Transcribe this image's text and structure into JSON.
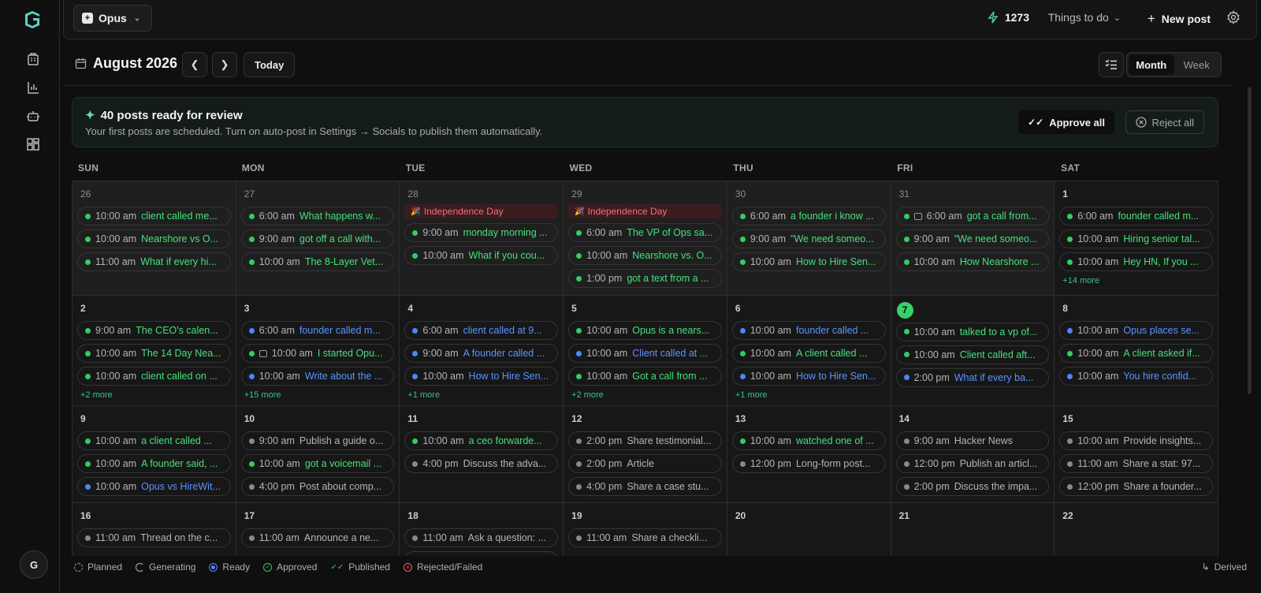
{
  "sidebar": {
    "logo": "logo-icon",
    "icons": [
      "building-icon",
      "bar-chart-icon",
      "bot-icon",
      "grid-icon"
    ],
    "avatar_initial": "G"
  },
  "topbar": {
    "workspace": "Opus",
    "credits": "1273",
    "todo_label": "Things to do",
    "new_post_label": "New post"
  },
  "calendar": {
    "month_title": "August 2026",
    "today_label": "Today",
    "view_month": "Month",
    "view_week": "Week",
    "weekdays": [
      "SUN",
      "MON",
      "TUE",
      "WED",
      "THU",
      "FRI",
      "SAT"
    ],
    "weeks": [
      [
        {
          "day": "26",
          "out": true,
          "posts": [
            {
              "time": "10:00 am",
              "title": "client called me...",
              "status": "green"
            },
            {
              "time": "10:00 am",
              "title": "Nearshore vs O...",
              "status": "green"
            },
            {
              "time": "11:00 am",
              "title": "What if every hi...",
              "status": "green"
            }
          ]
        },
        {
          "day": "27",
          "out": true,
          "posts": [
            {
              "time": "6:00 am",
              "title": "What happens w...",
              "status": "green"
            },
            {
              "time": "9:00 am",
              "title": "got off a call with...",
              "status": "green"
            },
            {
              "time": "10:00 am",
              "title": "The 8-Layer Vet...",
              "status": "green"
            }
          ]
        },
        {
          "day": "28",
          "out": true,
          "holiday": "Independence Day",
          "posts": [
            {
              "time": "9:00 am",
              "title": "monday morning ...",
              "status": "green"
            },
            {
              "time": "10:00 am",
              "title": "What if you cou...",
              "status": "green"
            }
          ]
        },
        {
          "day": "29",
          "out": true,
          "holiday": "Independence Day",
          "posts": [
            {
              "time": "6:00 am",
              "title": "The VP of Ops sa...",
              "status": "green"
            },
            {
              "time": "10:00 am",
              "title": "Nearshore vs. O...",
              "status": "green"
            },
            {
              "time": "1:00 pm",
              "title": "got a text from a ...",
              "status": "green"
            }
          ]
        },
        {
          "day": "30",
          "out": true,
          "posts": [
            {
              "time": "6:00 am",
              "title": "a founder i know ...",
              "status": "green"
            },
            {
              "time": "9:00 am",
              "title": "\"We need someo...",
              "status": "green"
            },
            {
              "time": "10:00 am",
              "title": "How to Hire Sen...",
              "status": "green"
            }
          ]
        },
        {
          "day": "31",
          "out": true,
          "posts": [
            {
              "time": "6:00 am",
              "title": "got a call from...",
              "status": "green",
              "image": true
            },
            {
              "time": "9:00 am",
              "title": "\"We need someo...",
              "status": "green"
            },
            {
              "time": "10:00 am",
              "title": "How Nearshore ...",
              "status": "green"
            }
          ]
        },
        {
          "day": "1",
          "out": false,
          "more": "+14 more",
          "posts": [
            {
              "time": "6:00 am",
              "title": "founder called m...",
              "status": "green"
            },
            {
              "time": "10:00 am",
              "title": "Hiring senior tal...",
              "status": "green"
            },
            {
              "time": "10:00 am",
              "title": "Hey HN, If you ...",
              "status": "green"
            }
          ]
        }
      ],
      [
        {
          "day": "2",
          "out": false,
          "more": "+2 more",
          "posts": [
            {
              "time": "9:00 am",
              "title": "The CEO's calen...",
              "status": "green"
            },
            {
              "time": "10:00 am",
              "title": "The 14 Day Nea...",
              "status": "green"
            },
            {
              "time": "10:00 am",
              "title": "client called on ...",
              "status": "green"
            }
          ]
        },
        {
          "day": "3",
          "out": false,
          "more": "+15 more",
          "posts": [
            {
              "time": "6:00 am",
              "title": "founder called m...",
              "status": "blue"
            },
            {
              "time": "10:00 am",
              "title": "I started Opu...",
              "status": "green",
              "image": true
            },
            {
              "time": "10:00 am",
              "title": "Write about the ...",
              "status": "blue"
            }
          ]
        },
        {
          "day": "4",
          "out": false,
          "more": "+1 more",
          "posts": [
            {
              "time": "6:00 am",
              "title": "client called at 9...",
              "status": "blue"
            },
            {
              "time": "9:00 am",
              "title": "A founder called ...",
              "status": "blue"
            },
            {
              "time": "10:00 am",
              "title": "How to Hire Sen...",
              "status": "blue"
            }
          ]
        },
        {
          "day": "5",
          "out": false,
          "more": "+2 more",
          "posts": [
            {
              "time": "10:00 am",
              "title": "Opus is a nears...",
              "status": "green"
            },
            {
              "time": "10:00 am",
              "title": "Client called at ...",
              "status": "blue"
            },
            {
              "time": "10:00 am",
              "title": "Got a call from ...",
              "status": "green"
            }
          ]
        },
        {
          "day": "6",
          "out": false,
          "more": "+1 more",
          "posts": [
            {
              "time": "10:00 am",
              "title": "founder called ...",
              "status": "blue"
            },
            {
              "time": "10:00 am",
              "title": "A client called ...",
              "status": "green"
            },
            {
              "time": "10:00 am",
              "title": "How to Hire Sen...",
              "status": "blue"
            }
          ]
        },
        {
          "day": "7",
          "out": false,
          "today": true,
          "posts": [
            {
              "time": "10:00 am",
              "title": "talked to a vp of...",
              "status": "green"
            },
            {
              "time": "10:00 am",
              "title": "Client called aft...",
              "status": "green"
            },
            {
              "time": "2:00 pm",
              "title": "What if every ba...",
              "status": "blue"
            }
          ]
        },
        {
          "day": "8",
          "out": false,
          "posts": [
            {
              "time": "10:00 am",
              "title": "Opus places se...",
              "status": "blue"
            },
            {
              "time": "10:00 am",
              "title": "A client asked if...",
              "status": "green"
            },
            {
              "time": "10:00 am",
              "title": "You hire confid...",
              "status": "blue"
            }
          ]
        }
      ],
      [
        {
          "day": "9",
          "out": false,
          "posts": [
            {
              "time": "10:00 am",
              "title": "a client called ...",
              "status": "green"
            },
            {
              "time": "10:00 am",
              "title": "A founder said, ...",
              "status": "green"
            },
            {
              "time": "10:00 am",
              "title": "Opus vs HireWit...",
              "status": "blue"
            }
          ]
        },
        {
          "day": "10",
          "out": false,
          "posts": [
            {
              "time": "9:00 am",
              "title": "Publish a guide o...",
              "status": "gray"
            },
            {
              "time": "10:00 am",
              "title": "got a voicemail ...",
              "status": "green"
            },
            {
              "time": "4:00 pm",
              "title": "Post about comp...",
              "status": "gray"
            }
          ]
        },
        {
          "day": "11",
          "out": false,
          "posts": [
            {
              "time": "10:00 am",
              "title": "a ceo forwarde...",
              "status": "green"
            },
            {
              "time": "4:00 pm",
              "title": "Discuss the adva...",
              "status": "gray"
            }
          ]
        },
        {
          "day": "12",
          "out": false,
          "posts": [
            {
              "time": "2:00 pm",
              "title": "Share testimonial...",
              "status": "gray"
            },
            {
              "time": "2:00 pm",
              "title": "Article",
              "status": "gray"
            },
            {
              "time": "4:00 pm",
              "title": "Share a case stu...",
              "status": "gray"
            }
          ]
        },
        {
          "day": "13",
          "out": false,
          "posts": [
            {
              "time": "10:00 am",
              "title": "watched one of ...",
              "status": "green"
            },
            {
              "time": "12:00 pm",
              "title": "Long-form post...",
              "status": "gray"
            }
          ]
        },
        {
          "day": "14",
          "out": false,
          "posts": [
            {
              "time": "9:00 am",
              "title": "Hacker News",
              "status": "gray"
            },
            {
              "time": "12:00 pm",
              "title": "Publish an articl...",
              "status": "gray"
            },
            {
              "time": "2:00 pm",
              "title": "Discuss the impa...",
              "status": "gray"
            }
          ]
        },
        {
          "day": "15",
          "out": false,
          "posts": [
            {
              "time": "10:00 am",
              "title": "Provide insights...",
              "status": "gray"
            },
            {
              "time": "11:00 am",
              "title": "Share a stat: 97...",
              "status": "gray"
            },
            {
              "time": "12:00 pm",
              "title": "Share a founder...",
              "status": "gray"
            }
          ]
        }
      ],
      [
        {
          "day": "16",
          "out": false,
          "posts": [
            {
              "time": "11:00 am",
              "title": "Thread on the c...",
              "status": "gray"
            }
          ]
        },
        {
          "day": "17",
          "out": false,
          "posts": [
            {
              "time": "11:00 am",
              "title": "Announce a ne...",
              "status": "gray"
            }
          ]
        },
        {
          "day": "18",
          "out": false,
          "posts": [
            {
              "time": "11:00 am",
              "title": "Ask a question: ...",
              "status": "gray"
            },
            {
              "time": "",
              "title": "",
              "status": "gray"
            }
          ]
        },
        {
          "day": "19",
          "out": false,
          "posts": [
            {
              "time": "11:00 am",
              "title": "Share a checkli...",
              "status": "gray"
            }
          ]
        },
        {
          "day": "20",
          "out": false,
          "posts": []
        },
        {
          "day": "21",
          "out": false,
          "posts": []
        },
        {
          "day": "22",
          "out": false,
          "posts": []
        }
      ]
    ]
  },
  "banner": {
    "title": "40 posts ready for review",
    "subtitle": "Your first posts are scheduled. Turn on auto-post in Settings → Socials to publish them automatically.",
    "approve_label": "Approve all",
    "reject_label": "Reject all"
  },
  "legend": {
    "items": [
      {
        "label": "Planned",
        "color": "#9a9a9a"
      },
      {
        "label": "Generating",
        "color": "#b0b0b0"
      },
      {
        "label": "Ready",
        "color": "#4c86ff"
      },
      {
        "label": "Approved",
        "color": "#2fcf5f"
      },
      {
        "label": "Published",
        "color": "#2fcf5f"
      },
      {
        "label": "Rejected/Failed",
        "color": "#ff5a64"
      }
    ],
    "derived_label": "Derived"
  },
  "colors": {
    "accent_green": "#2fcf5f",
    "accent_blue": "#4c86ff",
    "today_badge": "#3ad06a",
    "holiday_red": "#ff6b73"
  }
}
